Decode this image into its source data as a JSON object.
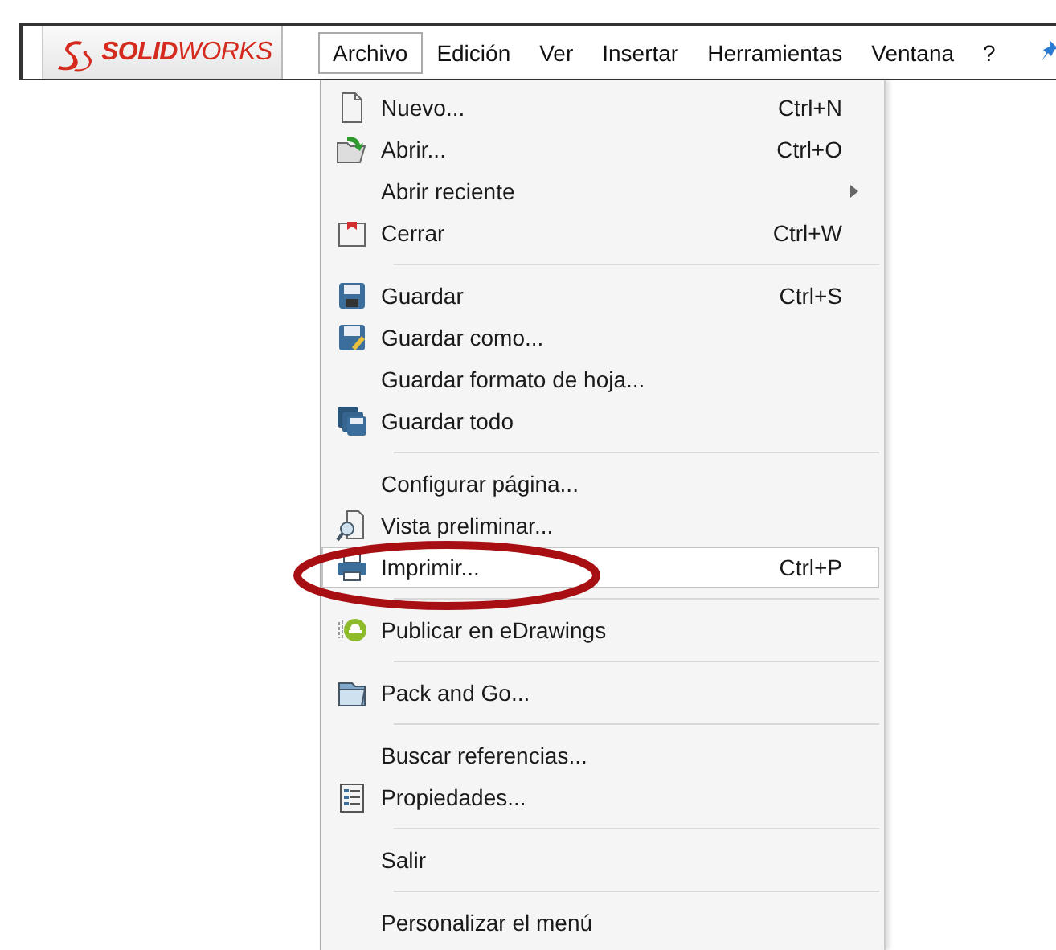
{
  "logo": {
    "text": "**SOLID**WORKS"
  },
  "menubar": [
    {
      "label": "Archivo",
      "selected": true
    },
    {
      "label": "Edición",
      "selected": false
    },
    {
      "label": "Ver",
      "selected": false
    },
    {
      "label": "Insertar",
      "selected": false
    },
    {
      "label": "Herramientas",
      "selected": false
    },
    {
      "label": "Ventana",
      "selected": false
    },
    {
      "label": "?",
      "selected": false
    }
  ],
  "menu": [
    {
      "kind": "item",
      "label": "Nuevo...",
      "shortcut": "Ctrl+N",
      "selected": false
    },
    {
      "kind": "item",
      "label": "Abrir...",
      "shortcut": "Ctrl+O",
      "selected": false
    },
    {
      "kind": "item",
      "label": "Abrir reciente",
      "submenu": true,
      "selected": false
    },
    {
      "kind": "item",
      "label": "Cerrar",
      "shortcut": "Ctrl+W",
      "selected": false
    },
    {
      "kind": "separator"
    },
    {
      "kind": "item",
      "label": "Guardar",
      "shortcut": "Ctrl+S",
      "selected": false
    },
    {
      "kind": "item",
      "label": "Guardar como...",
      "selected": false
    },
    {
      "kind": "item",
      "label": "Guardar formato de hoja...",
      "selected": false
    },
    {
      "kind": "item",
      "label": "Guardar todo",
      "selected": false
    },
    {
      "kind": "separator"
    },
    {
      "kind": "item",
      "label": "Configurar página...",
      "selected": false
    },
    {
      "kind": "item",
      "label": "Vista preliminar...",
      "selected": false
    },
    {
      "kind": "item",
      "label": "Imprimir...",
      "shortcut": "Ctrl+P",
      "selected": true
    },
    {
      "kind": "separator"
    },
    {
      "kind": "item",
      "label": "Publicar en eDrawings",
      "selected": false
    },
    {
      "kind": "separator"
    },
    {
      "kind": "item",
      "label": "Pack and Go...",
      "selected": false
    },
    {
      "kind": "separator"
    },
    {
      "kind": "item",
      "label": "Buscar referencias...",
      "selected": false
    },
    {
      "kind": "item",
      "label": "Propiedades...",
      "selected": false
    },
    {
      "kind": "separator"
    },
    {
      "kind": "item",
      "label": "Salir",
      "selected": false
    },
    {
      "kind": "separator"
    },
    {
      "kind": "item",
      "label": "Personalizar el menú",
      "selected": false
    }
  ]
}
